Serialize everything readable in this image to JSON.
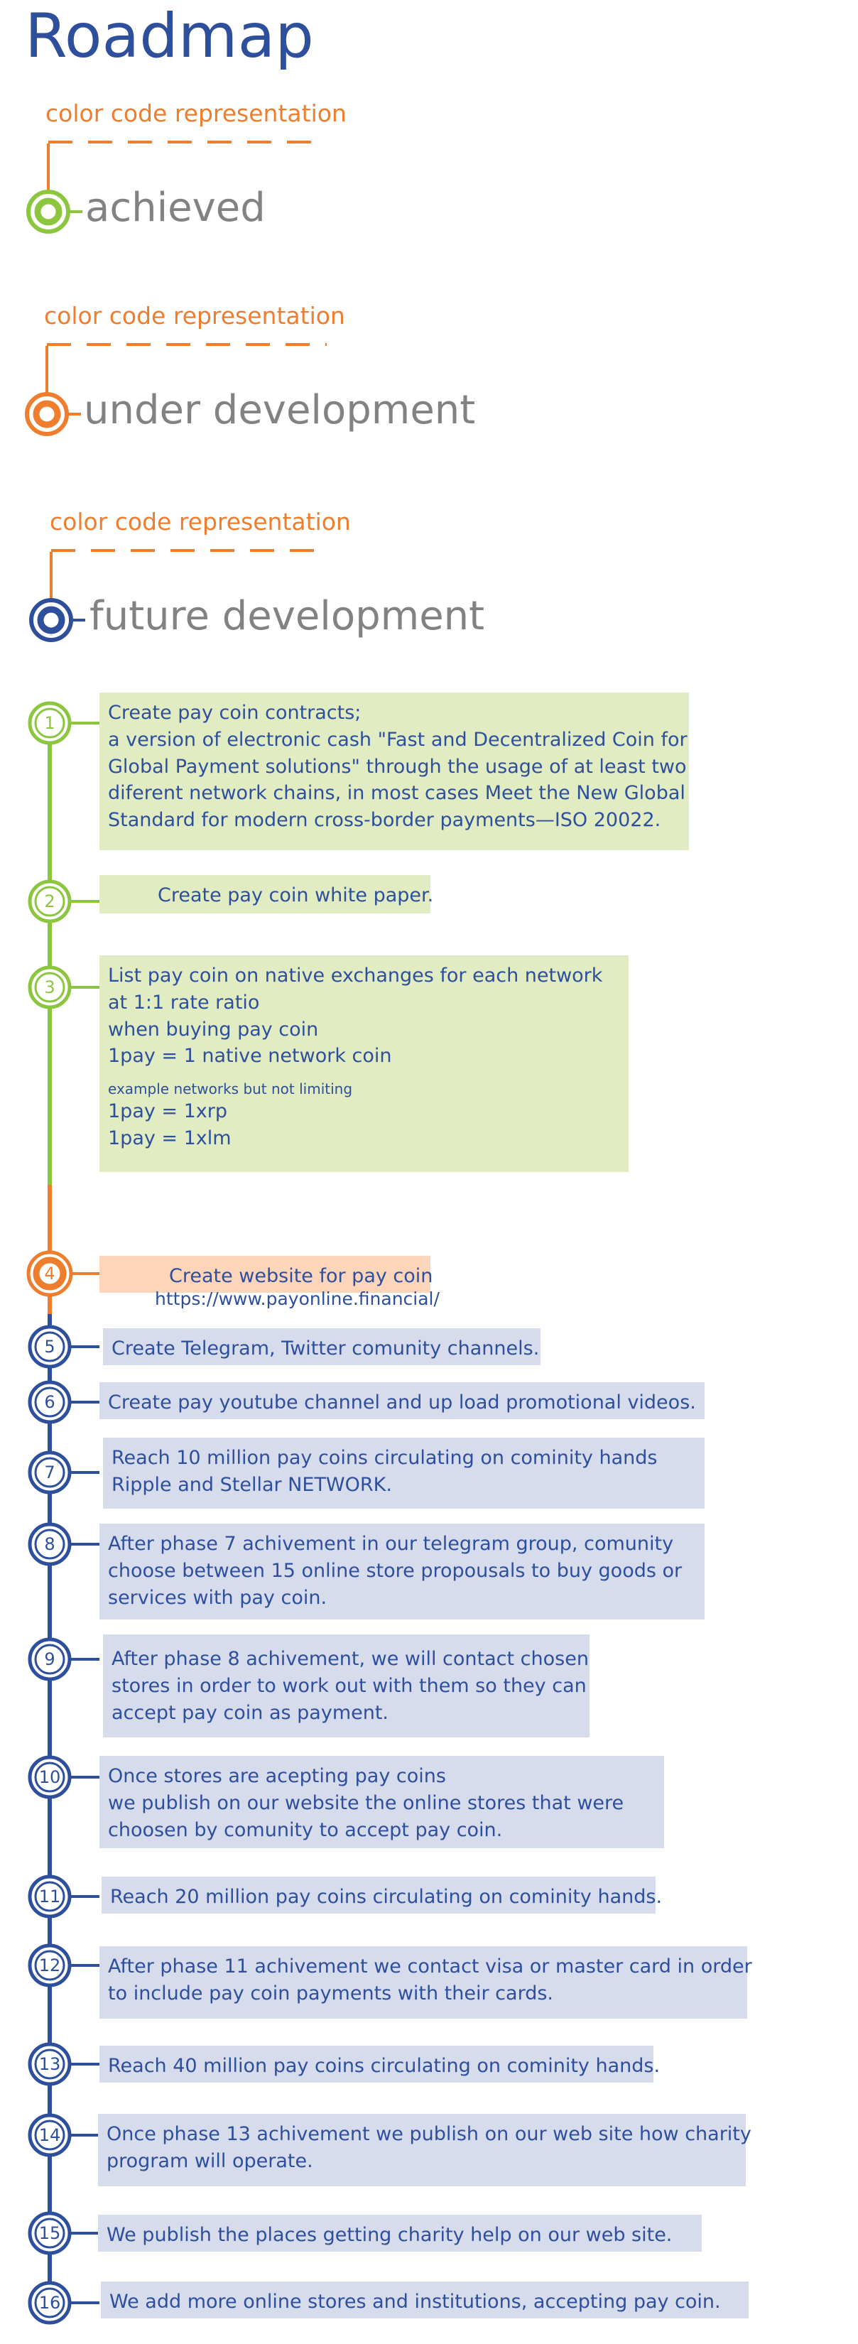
{
  "title": "Roadmap",
  "legend": [
    {
      "caption": "color code representation",
      "label": "achieved",
      "color": "#8cc63f"
    },
    {
      "caption": "color code representation",
      "label": "under development",
      "color": "#ef7d2e"
    },
    {
      "caption": "color code representation",
      "label": "future development",
      "color": "#2e4f9b"
    }
  ],
  "colors": {
    "achieved": "#8cc63f",
    "under_development": "#ef7d2e",
    "future_development": "#2e4f9b",
    "achieved_box": "#e1ecc3",
    "under_development_box": "#fdd5bb",
    "future_development_box": "#d7dced",
    "text": "#2e4f9b",
    "legend_label": "#808284"
  },
  "steps": [
    {
      "number": "1",
      "status": "achieved",
      "lines": [
        "Create pay coin contracts;",
        "a version of electronic cash  \"Fast and Decentralized Coin for",
        "Global Payment solutions\" through the usage of at least two",
        "diferent network chains, in most cases Meet the New Global",
        "Standard for modern cross-border payments—ISO 20022."
      ]
    },
    {
      "number": "2",
      "status": "achieved",
      "lines": [
        "Create pay coin white paper."
      ]
    },
    {
      "number": "3",
      "status": "achieved",
      "lines": [
        "List pay coin on native exchanges for each network",
        "at 1:1 rate ratio",
        "when buying pay coin",
        "1pay = 1 native network coin"
      ],
      "note": "example networks but not limiting",
      "extra_lines": [
        "1pay = 1xrp",
        "1pay = 1xlm"
      ]
    },
    {
      "number": "4",
      "status": "under_development",
      "lines": [
        "Create website for pay coin"
      ],
      "url": "https://www.payonline.financial/"
    },
    {
      "number": "5",
      "status": "future_development",
      "lines": [
        "Create Telegram, Twitter comunity channels."
      ]
    },
    {
      "number": "6",
      "status": "future_development",
      "lines": [
        "Create pay youtube channel and up load promotional videos."
      ]
    },
    {
      "number": "7",
      "status": "future_development",
      "lines": [
        "Reach 10 million pay coins circulating on cominity hands",
        "Ripple and Stellar NETWORK."
      ]
    },
    {
      "number": "8",
      "status": "future_development",
      "lines": [
        "After phase 7 achivement in our telegram group, comunity",
        "choose between 15 online store propousals to buy goods or",
        "services with pay coin."
      ]
    },
    {
      "number": "9",
      "status": "future_development",
      "lines": [
        "After phase 8 achivement, we will contact chosen",
        "stores in order to work out with them so they can",
        "accept pay coin as payment."
      ]
    },
    {
      "number": "10",
      "status": "future_development",
      "lines": [
        "Once stores are acepting pay coins",
        "we publish on our website the online stores that were",
        "choosen by comunity to accept pay coin."
      ]
    },
    {
      "number": "11",
      "status": "future_development",
      "lines": [
        "Reach 20 million pay coins circulating on cominity hands."
      ]
    },
    {
      "number": "12",
      "status": "future_development",
      "lines": [
        "After phase 11 achivement we contact visa or master card in order",
        "to include pay coin payments with their cards."
      ]
    },
    {
      "number": "13",
      "status": "future_development",
      "lines": [
        "Reach 40 million pay coins circulating on cominity hands."
      ]
    },
    {
      "number": "14",
      "status": "future_development",
      "lines": [
        "Once phase 13 achivement we publish on our web site how charity",
        "program will operate."
      ]
    },
    {
      "number": "15",
      "status": "future_development",
      "lines": [
        "We publish the places getting charity help on our web site."
      ]
    },
    {
      "number": "16",
      "status": "future_development",
      "lines": [
        "We add more online stores and institutions, accepting pay coin."
      ]
    }
  ]
}
